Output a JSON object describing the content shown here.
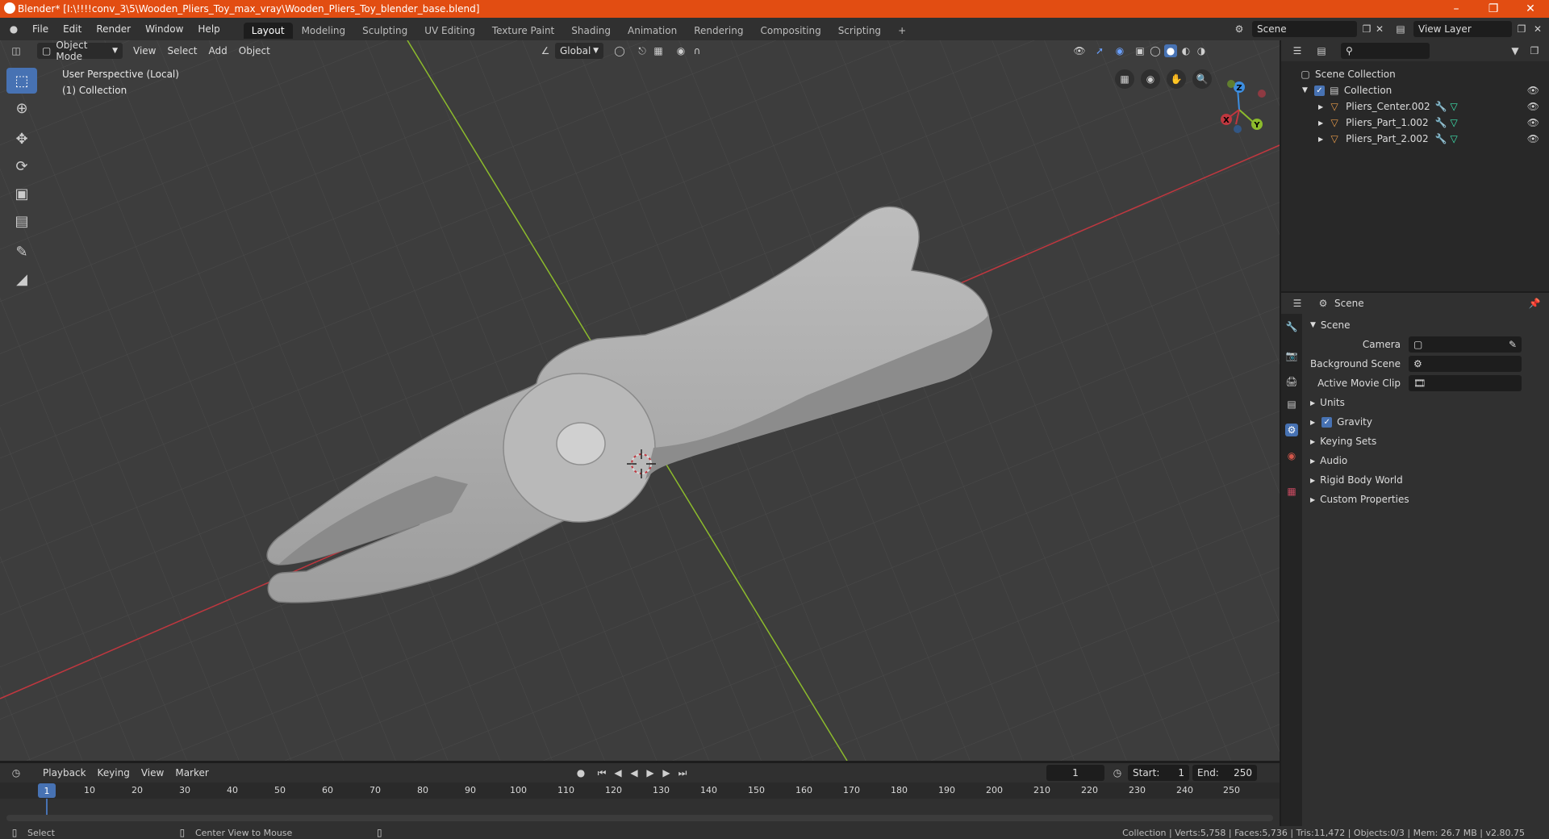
{
  "window": {
    "title": "Blender* [I:\\!!!!conv_3\\5\\Wooden_Pliers_Toy_max_vray\\Wooden_Pliers_Toy_blender_base.blend]"
  },
  "menu": {
    "items": [
      "File",
      "Edit",
      "Render",
      "Window",
      "Help"
    ],
    "workspaces": [
      "Layout",
      "Modeling",
      "Sculpting",
      "UV Editing",
      "Texture Paint",
      "Shading",
      "Animation",
      "Rendering",
      "Compositing",
      "Scripting"
    ],
    "active_workspace": "Layout",
    "scene_name": "Scene",
    "view_layer": "View Layer"
  },
  "viewport": {
    "mode": "Object Mode",
    "menus": [
      "View",
      "Select",
      "Add",
      "Object"
    ],
    "orientation": "Global",
    "perspective_label": "User Perspective (Local)",
    "collection_label": "(1) Collection",
    "gizmo_axes": {
      "x": "X",
      "y": "Y",
      "z": "Z"
    }
  },
  "outliner": {
    "root": "Scene Collection",
    "collection": "Collection",
    "objects": [
      "Pliers_Center.002",
      "Pliers_Part_1.002",
      "Pliers_Part_2.002"
    ]
  },
  "properties": {
    "header": "Scene",
    "panel": "Scene",
    "camera_label": "Camera",
    "background_scene_label": "Background Scene",
    "active_movie_clip_label": "Active Movie Clip",
    "sections": [
      "Units",
      "Gravity",
      "Keying Sets",
      "Audio",
      "Rigid Body World",
      "Custom Properties"
    ],
    "gravity_checked": true
  },
  "timeline": {
    "menus": [
      "Playback",
      "Keying",
      "View",
      "Marker"
    ],
    "current_frame": "1",
    "start_label": "Start:",
    "start": "1",
    "end_label": "End:",
    "end": "250",
    "ruler": [
      "1",
      "10",
      "20",
      "30",
      "40",
      "50",
      "60",
      "70",
      "80",
      "90",
      "100",
      "110",
      "120",
      "130",
      "140",
      "150",
      "160",
      "170",
      "180",
      "190",
      "200",
      "210",
      "220",
      "230",
      "240",
      "250"
    ]
  },
  "status": {
    "left_action": "Select",
    "middle_action": "Center View to Mouse",
    "stats": "Collection | Verts:5,758 | Faces:5,736 | Tris:11,472 | Objects:0/3 | Mem: 26.7 MB | v2.80.75"
  },
  "colors": {
    "accent": "#4772b3",
    "title_bar": "#e24d12",
    "x_axis": "#c0373f",
    "y_axis": "#8cbb2c",
    "z_axis": "#3d8ee0"
  }
}
